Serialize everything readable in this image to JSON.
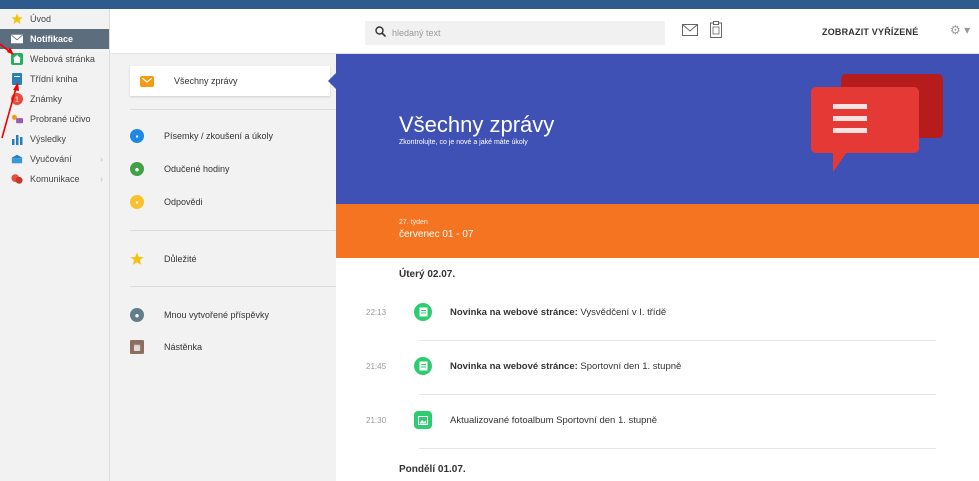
{
  "sidebar": {
    "items": [
      {
        "label": "Úvod",
        "icon": "star-icon"
      },
      {
        "label": "Notifikace",
        "icon": "envelope-icon"
      },
      {
        "label": "Webová stránka",
        "icon": "home-icon"
      },
      {
        "label": "Třídní kniha",
        "icon": "book-icon"
      },
      {
        "label": "Známky",
        "icon": "grade-icon"
      },
      {
        "label": "Probrané učivo",
        "icon": "topics-icon"
      },
      {
        "label": "Výsledky",
        "icon": "bar-chart-icon"
      },
      {
        "label": "Vyučování",
        "icon": "school-icon"
      },
      {
        "label": "Komunikace",
        "icon": "chat-icon"
      }
    ]
  },
  "header": {
    "search_placeholder": "hledaný text",
    "show_resolved": "ZOBRAZIT VYŘÍZENÉ"
  },
  "midnav": {
    "items": [
      {
        "label": "Všechny zprávy"
      },
      {
        "label": "Písemky / zkoušení a úkoly"
      },
      {
        "label": "Odučené hodiny"
      },
      {
        "label": "Odpovědi"
      },
      {
        "label": "Důležité"
      },
      {
        "label": "Mnou vytvořené příspěvky"
      },
      {
        "label": "Nástěnka"
      }
    ]
  },
  "banner": {
    "title": "Všechny zprávy",
    "subtitle": "Zkontrolujte, co je nové a jaké máte úkoly"
  },
  "week": {
    "label": "27. týden",
    "range": "červenec 01 - 07"
  },
  "days": [
    {
      "label": "Úterý 02.07.",
      "messages": [
        {
          "time": "22:13",
          "bold": "Novinka na webové stránce:",
          "text": " Vysvědčení v I. třídě"
        },
        {
          "time": "21:45",
          "bold": "Novinka na webové stránce:",
          "text": " Sportovní den 1. stupně"
        },
        {
          "time": "21:30",
          "bold": "",
          "text": "Aktualizované fotoalbum Sportovní den 1. stupně"
        }
      ]
    },
    {
      "label": "Pondělí 01.07.",
      "messages": []
    }
  ],
  "colors": {
    "banner": "#3f51b5",
    "orange": "#f47421",
    "green": "#2ecc71",
    "topline": "#2e5a8d",
    "sidebar_active": "#5c6e7e"
  }
}
